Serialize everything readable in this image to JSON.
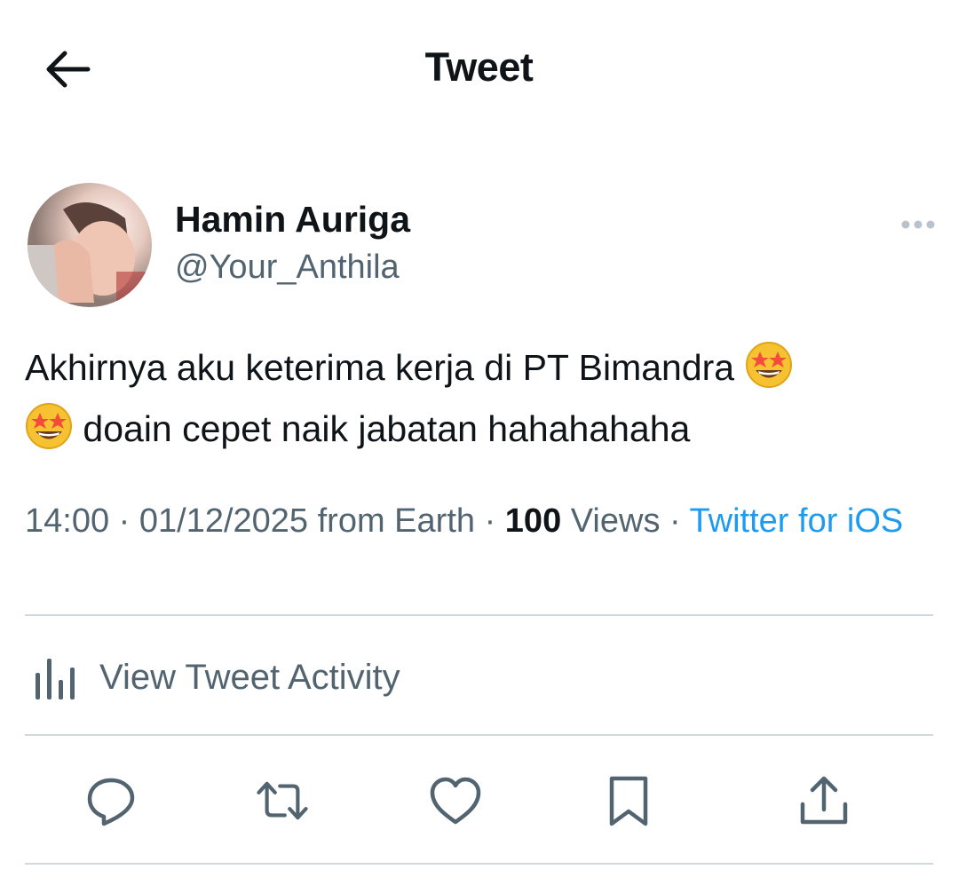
{
  "header": {
    "back_icon": "arrow-left-icon",
    "title": "Tweet"
  },
  "author": {
    "display_name": "Hamin Auriga",
    "handle": "@Your_Anthila",
    "more_icon": "more-horizontal-icon"
  },
  "tweet": {
    "text_line1": "Akhirnya aku keterima kerja di PT Bimandra",
    "text_line2": "doain cepet naik jabatan hahahahaha",
    "emoji": "star-struck-emoji"
  },
  "meta": {
    "time": "14:00",
    "separator": "·",
    "date": "01/12/2025",
    "location": "from Earth",
    "views_count": "100",
    "views_label": "Views",
    "source": "Twitter for iOS"
  },
  "activity": {
    "icon": "analytics-icon",
    "label": "View Tweet Activity"
  },
  "actions": [
    {
      "name": "reply-icon"
    },
    {
      "name": "retweet-icon"
    },
    {
      "name": "like-icon"
    },
    {
      "name": "bookmark-icon"
    },
    {
      "name": "share-icon"
    }
  ],
  "colors": {
    "primary_text": "#0f1419",
    "secondary_text": "#536471",
    "link": "#1d9bf0",
    "divider": "#cfd9de"
  }
}
